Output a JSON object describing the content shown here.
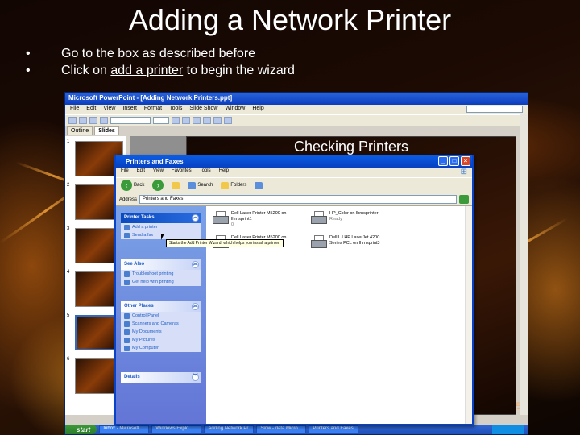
{
  "slide": {
    "title": "Adding a Network Printer",
    "bullets": [
      {
        "marker": "•",
        "text": "Go to the box as described before"
      },
      {
        "marker": "•",
        "prefix": "Click on ",
        "link": "add a printer",
        "suffix": " to begin the wizard"
      }
    ]
  },
  "powerpoint": {
    "window_title": "Microsoft PowerPoint - [Adding Network Printers.ppt]",
    "menu": [
      "File",
      "Edit",
      "View",
      "Insert",
      "Format",
      "Tools",
      "Slide Show",
      "Window",
      "Help"
    ],
    "tabs": [
      "Outline",
      "Slides"
    ],
    "slide_numbers": [
      "1",
      "2",
      "3",
      "4",
      "5",
      "6"
    ],
    "current_slide_title": "Checking Printers",
    "page_number": "5"
  },
  "taskbar": {
    "start_label": "start",
    "buttons": [
      "Inbox - Microsoft...",
      "Windows Explo...",
      "Adding Network Pr...",
      "Slow - data Micro...",
      "Printers and Faxes"
    ]
  },
  "printers_window": {
    "title": "Printers and Faxes",
    "menu": [
      "File",
      "Edit",
      "View",
      "Favorites",
      "Tools",
      "Help"
    ],
    "toolbar": {
      "back": "Back",
      "search": "Search",
      "folders": "Folders"
    },
    "address_label": "Address",
    "address_value": "Printers and Faxes",
    "printer_tasks": {
      "header": "Printer Tasks",
      "items": [
        "Add a printer",
        "Send a fax"
      ]
    },
    "see_also": {
      "header": "See Also",
      "items": [
        "Troubleshoot printing",
        "Get help with printing"
      ]
    },
    "other_places": {
      "header": "Other Places",
      "items": [
        "Control Panel",
        "Scanners and Cameras",
        "My Documents",
        "My Pictures",
        "My Computer"
      ]
    },
    "details": {
      "header": "Details"
    },
    "printers": [
      {
        "name": "Dell Laser Printer M5200 on",
        "detail": "lhrnsprint1",
        "status": "0"
      },
      {
        "name": "HP_Color on lhrnsprinter",
        "detail": "",
        "status": "Ready"
      },
      {
        "name": "Dell Laser Printer M5200 on ...",
        "detail": "",
        "status": "0"
      },
      {
        "name": "Dell LJ HP LaserJet 4200",
        "detail": "Series PCL on lhrnsprint3",
        "status": ""
      }
    ],
    "tooltip": "Starts the Add Printer Wizard, which helps you install a printer."
  }
}
